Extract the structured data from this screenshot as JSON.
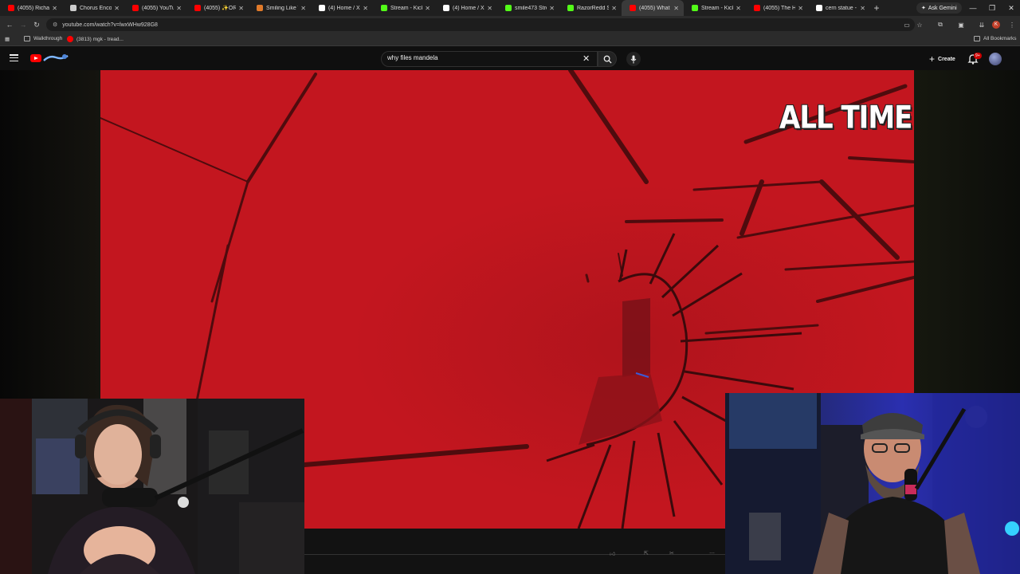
{
  "browser": {
    "tabs": [
      {
        "title": "(4055) Richard",
        "favicon": "youtube-icon",
        "color": "#ff0000"
      },
      {
        "title": "Chorus Encore",
        "favicon": "puzzle-icon",
        "color": "#cccccc"
      },
      {
        "title": "(4055) YouTube",
        "favicon": "youtube-icon",
        "color": "#ff0000"
      },
      {
        "title": "(4055) ✨ORIG",
        "favicon": "youtube-icon",
        "color": "#ff0000"
      },
      {
        "title": "Smiling Like Wi",
        "favicon": "globe-icon",
        "color": "#e07a2a"
      },
      {
        "title": "(4) Home / X",
        "favicon": "x-icon",
        "color": "#ffffff"
      },
      {
        "title": "Stream - Kick D",
        "favicon": "kick-icon",
        "color": "#53fc18"
      },
      {
        "title": "(4) Home / X",
        "favicon": "x-icon",
        "color": "#ffffff"
      },
      {
        "title": "smile473 Strea",
        "favicon": "kick-icon",
        "color": "#53fc18"
      },
      {
        "title": "RazorRedd Stre",
        "favicon": "kick-icon",
        "color": "#53fc18"
      },
      {
        "title": "(4055) What Co",
        "favicon": "youtube-icon",
        "color": "#ff0000",
        "active": true
      },
      {
        "title": "Stream - Kick D",
        "favicon": "kick-icon",
        "color": "#53fc18"
      },
      {
        "title": "(4055) The Hun",
        "favicon": "youtube-icon",
        "color": "#ff0000"
      },
      {
        "title": "cern statue - Go",
        "favicon": "google-icon",
        "color": "#ffffff"
      }
    ],
    "ask_gemini": "Ask Gemini",
    "url": "youtube.com/watch?v=lwxWHw928G8",
    "bookmarks": [
      {
        "label": "Walkthrough",
        "icon": "folder-icon"
      },
      {
        "label": "(3813) mgk - tread...",
        "icon": "youtube-icon"
      }
    ],
    "all_bookmarks": "All Bookmarks",
    "profile_initial": "K",
    "window_controls": {
      "minimize": "—",
      "restore": "❐",
      "close": "✕"
    }
  },
  "youtube": {
    "search_query": "why files mandela",
    "create_label": "Create",
    "notification_badge": "9+"
  },
  "video": {
    "caption": "ALL TIME",
    "bg_color": "#c3161f"
  }
}
